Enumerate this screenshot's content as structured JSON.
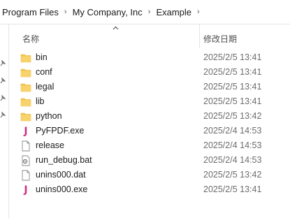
{
  "breadcrumb": {
    "items": [
      "Program Files",
      "My Company, Inc",
      "Example"
    ],
    "separator": "›"
  },
  "header": {
    "name_col": "名称",
    "date_col": "修改日期",
    "sort": "ascending"
  },
  "files": [
    {
      "name": "bin",
      "date": "2025/2/5 13:41",
      "icon": "folder-icon"
    },
    {
      "name": "conf",
      "date": "2025/2/5 13:41",
      "icon": "folder-icon"
    },
    {
      "name": "legal",
      "date": "2025/2/5 13:41",
      "icon": "folder-icon"
    },
    {
      "name": "lib",
      "date": "2025/2/5 13:41",
      "icon": "folder-icon"
    },
    {
      "name": "python",
      "date": "2025/2/5 13:42",
      "icon": "folder-icon"
    },
    {
      "name": "PyFPDF.exe",
      "date": "2025/2/4 14:53",
      "icon": "java-exe-icon"
    },
    {
      "name": "release",
      "date": "2025/2/4 14:53",
      "icon": "file-icon"
    },
    {
      "name": "run_debug.bat",
      "date": "2025/2/4 14:53",
      "icon": "batch-file-icon"
    },
    {
      "name": "unins000.dat",
      "date": "2025/2/5 13:42",
      "icon": "file-icon"
    },
    {
      "name": "unins000.exe",
      "date": "2025/2/5 13:41",
      "icon": "java-exe-icon"
    }
  ],
  "colors": {
    "folder": "#f3c550",
    "folder_dark": "#e6b23a",
    "java_icon": "#d32f7f",
    "date_text": "#6d6d6d"
  }
}
